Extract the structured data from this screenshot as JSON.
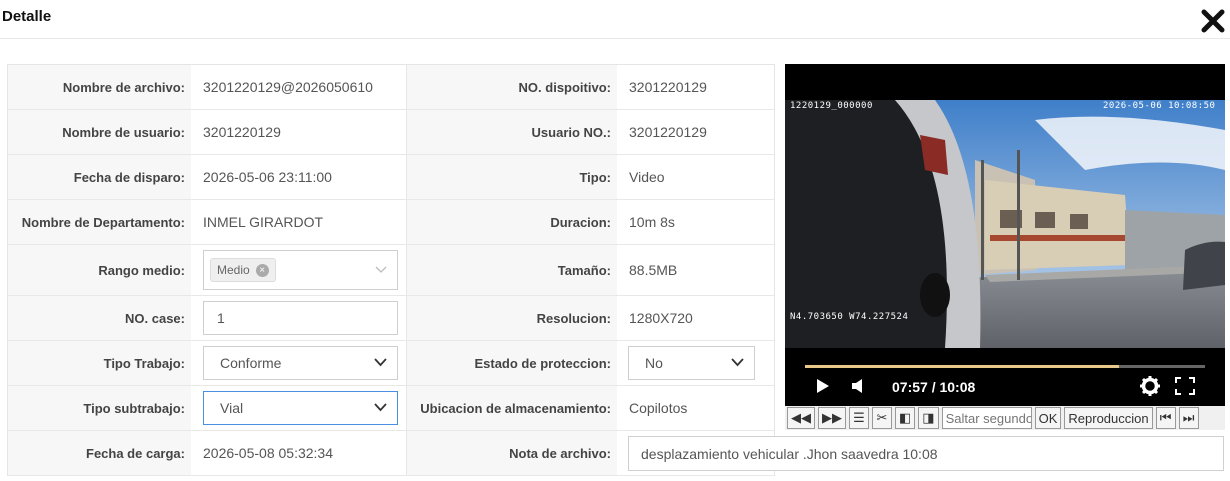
{
  "header": {
    "title": "Detalle"
  },
  "rows": [
    {
      "label1": "Nombre de archivo:",
      "value1": "3201220129@2026050610",
      "label2": "NO. dispoitivo:",
      "value2": "3201220129"
    },
    {
      "label1": "Nombre de usuario:",
      "value1": "3201220129",
      "label2": "Usuario NO.:",
      "value2": "3201220129"
    },
    {
      "label1": "Fecha de disparo:",
      "value1": "2026-05-06 23:11:00",
      "label2": "Tipo:",
      "value2": "Video"
    },
    {
      "label1": "Nombre de Departamento:",
      "value1": "INMEL GIRARDOT",
      "label2": "Duracion:",
      "value2": "10m 8s"
    },
    {
      "label1": "Rango medio:",
      "tag": "Medio",
      "label2": "Tamaño:",
      "value2": "88.5MB"
    },
    {
      "label1": "NO. case:",
      "input_value": "1",
      "label2": "Resolucion:",
      "value2": "1280X720"
    },
    {
      "label1": "Tipo Trabajo:",
      "select_value": "Conforme",
      "label2": "Estado de proteccion:",
      "select2_value": "No"
    },
    {
      "label1": "Tipo subtrabajo:",
      "select_value": "Vial",
      "label2": "Ubicacion de almacenamiento:",
      "value2": "Copilotos"
    },
    {
      "label1": "Fecha de carga:",
      "value1": "2026-05-08 05:32:34",
      "label2": "Nota de archivo:",
      "nota": "desplazamiento vehicular .Jhon saavedra 10:08"
    }
  ],
  "video": {
    "osd_top_left": "1220129_000000",
    "osd_top_right": "2026-05-06 10:08:50",
    "osd_bottom_left": "N4.703650 W74.227524",
    "time": "07:57 / 10:08",
    "progress": 0.785
  },
  "toolbar": {
    "seek_placeholder": "Saltar segundos",
    "ok_label": "OK",
    "playback_label": "Reproduccion"
  }
}
